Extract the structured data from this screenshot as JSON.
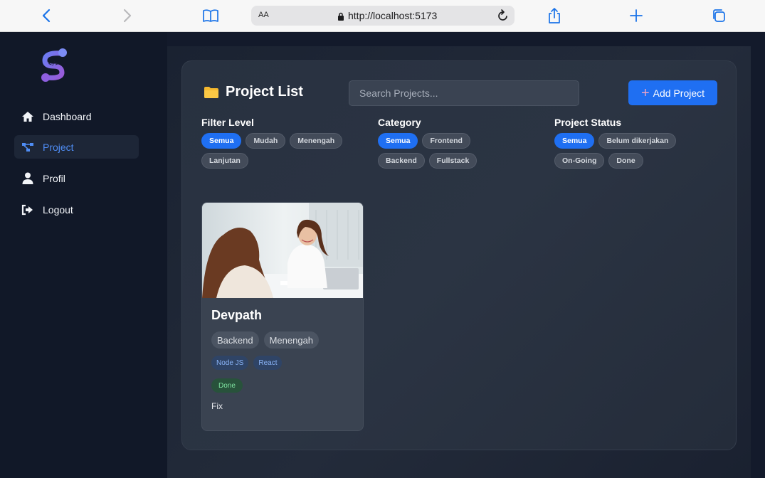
{
  "browser": {
    "text_size_label": "AA",
    "url": "http://localhost:5173"
  },
  "sidebar": {
    "items": [
      {
        "label": "Dashboard",
        "icon": "home-icon"
      },
      {
        "label": "Project",
        "icon": "project-tree-icon",
        "active": true
      },
      {
        "label": "Profil",
        "icon": "user-icon"
      },
      {
        "label": "Logout",
        "icon": "logout-icon"
      }
    ]
  },
  "header": {
    "title": "Project List",
    "search_placeholder": "Search Projects...",
    "add_button_label": "Add Project"
  },
  "filters": {
    "level": {
      "label": "Filter Level",
      "options": [
        "Semua",
        "Mudah",
        "Menengah",
        "Lanjutan"
      ],
      "selected": "Semua"
    },
    "category": {
      "label": "Category",
      "options": [
        "Semua",
        "Frontend",
        "Backend",
        "Fullstack"
      ],
      "selected": "Semua"
    },
    "status": {
      "label": "Project Status",
      "options": [
        "Semua",
        "Belum dikerjakan",
        "On-Going",
        "Done"
      ],
      "selected": "Semua"
    }
  },
  "projects": [
    {
      "title": "Devpath",
      "category": "Backend",
      "level": "Menengah",
      "technologies": [
        "Node JS",
        "React"
      ],
      "status": "Done",
      "description": "Fix"
    }
  ],
  "colors": {
    "accent": "#1f6ff2",
    "sidebar_active_text": "#4f8df5",
    "status_done": "#7ee2a0"
  }
}
